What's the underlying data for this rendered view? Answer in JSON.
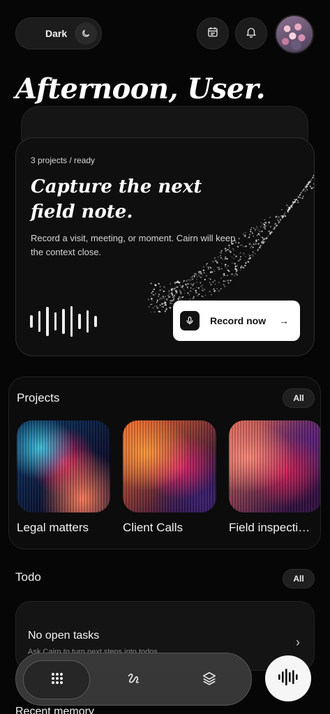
{
  "header": {
    "theme_label": "Dark",
    "theme_icon": "moon-icon",
    "calendar_icon": "calendar-icon",
    "bell_icon": "bell-icon",
    "avatar": "avatar"
  },
  "greeting": "Afternoon, User.",
  "hero": {
    "meta": "3 projects / ready",
    "title": "Capture the next field note.",
    "description": "Record a visit, meeting, or moment. Cairn will keep the context close.",
    "record_label": "Record now",
    "record_arrow": "→"
  },
  "projects": {
    "title": "Projects",
    "all_label": "All",
    "items": [
      {
        "label": "Legal matters"
      },
      {
        "label": "Client Calls"
      },
      {
        "label": "Field inspecti…"
      }
    ]
  },
  "todo": {
    "title": "Todo",
    "all_label": "All",
    "empty_title": "No open tasks",
    "empty_subtitle": "Ask Cairn to turn next steps into todos.",
    "chevron": "›"
  },
  "recent": {
    "title": "Recent memory"
  },
  "nav": {
    "items": [
      "grid-icon",
      "scribble-icon",
      "layers-icon"
    ],
    "fab_icon": "waveform-icon"
  },
  "colors": {
    "background": "#060606",
    "card": "#0f0f0f",
    "accent_white": "#ffffff"
  }
}
